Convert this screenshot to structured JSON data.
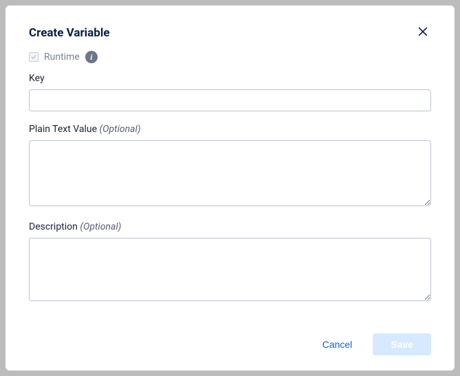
{
  "modal": {
    "title": "Create Variable",
    "runtime_label": "Runtime",
    "key_label": "Key",
    "key_value": "",
    "plain_text_label": "Plain Text Value",
    "plain_text_optional": "(Optional)",
    "plain_text_value": "",
    "description_label": "Description",
    "description_optional": "(Optional)",
    "description_value": "",
    "cancel_label": "Cancel",
    "save_label": "Save"
  }
}
